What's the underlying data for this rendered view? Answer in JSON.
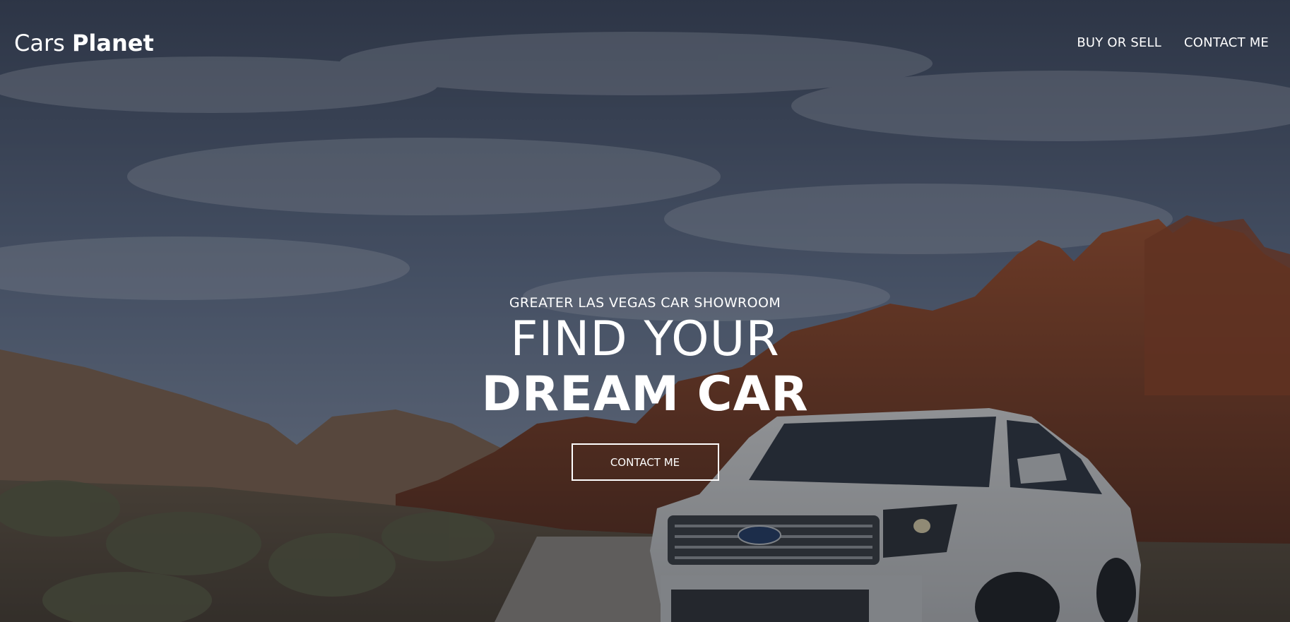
{
  "brand": {
    "name_light": "Cars",
    "name_bold": "Planet"
  },
  "nav": {
    "links": [
      {
        "label": "BUY OR SELL"
      },
      {
        "label": "CONTACT ME"
      }
    ]
  },
  "hero": {
    "subtitle": "GREATER LAS VEGAS CAR SHOWROOM",
    "headline_line1": "FIND YOUR",
    "headline_line2": "DREAM CAR",
    "cta_label": "CONTACT ME",
    "background_scene": "desert-road-white-suv-photo",
    "car_badge": "Ford"
  },
  "colors": {
    "text": "#ffffff",
    "sky": "#4f5f7b",
    "rock": "#8a3f22",
    "overlay": "rgba(25,28,36,0.45)"
  }
}
